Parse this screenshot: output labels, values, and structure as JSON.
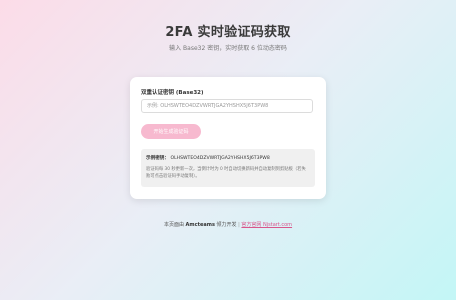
{
  "header": {
    "title": "2FA 实时验证码获取",
    "subtitle": "输入 Base32 密钥，实时获取 6 位动态密码"
  },
  "form": {
    "secret_label": "双重认证密钥 (Base32)",
    "secret_value": "",
    "secret_placeholder": "示例: OLHSWTEO4DZVWRTJGA2YHSHX5J6T3PW8",
    "start_button_label": "开始生成验证码"
  },
  "result": {
    "example_label": "示例密钥：",
    "example_value": "OLHSWTEO4DZVWRTJGA2YHSHX5J6T3PW8",
    "note": "验证码每 30 秒更新一次，当倒计时为 0 时自动切换新码并自动复制到剪贴板（若失败可点击验证码手动复制）。"
  },
  "footer": {
    "prefix": "本页面由",
    "brand": "Amcteams",
    "suffix": "倾力开发",
    "separator": "|",
    "link_label": "官方官网 Njstart.com"
  },
  "colors": {
    "accent": "#f7b9cf",
    "link": "#d9568b",
    "background_start": "#fcdce8",
    "background_end": "#c3f6f6"
  }
}
